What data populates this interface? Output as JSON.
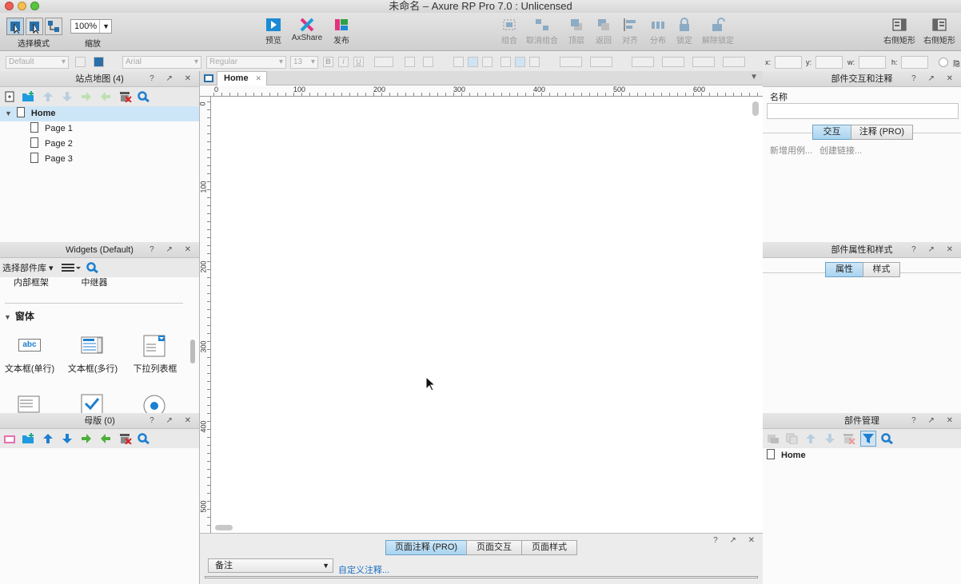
{
  "window": {
    "title": "未命名 – Axure RP Pro 7.0 : Unlicensed"
  },
  "toolbar": {
    "select_mode_label": "选择模式",
    "zoom_value": "100%",
    "zoom_label": "缩放",
    "preview_label": "预览",
    "axshare_label": "AxShare",
    "publish_label": "发布",
    "group_label": "组合",
    "ungroup_label": "取消组合",
    "top_label": "顶层",
    "back_label": "返回",
    "align_label": "对齐",
    "distribute_label": "分布",
    "lock_label": "锁定",
    "unlock_label": "解除锁定",
    "right_rect1_label": "右侧矩形",
    "right_rect2_label": "右侧矩形"
  },
  "format": {
    "style": "Default",
    "font": "Arial",
    "weight": "Regular",
    "size": "13",
    "x_label": "x:",
    "y_label": "y:",
    "w_label": "w:",
    "h_label": "h:",
    "hidden_label": "隐"
  },
  "sitemap": {
    "title": "站点地图 (4)",
    "controls": "? ↗ ✕",
    "home": "Home",
    "pages": [
      "Page 1",
      "Page 2",
      "Page 3"
    ]
  },
  "widgets": {
    "title": "Widgets (Default)",
    "controls": "? ↗ ✕",
    "library_select": "选择部件库",
    "partial_items": [
      "内部框架",
      "中继器"
    ],
    "section": "窗体",
    "items": [
      "文本框(单行)",
      "文本框(多行)",
      "下拉列表框"
    ],
    "icon_text": "abc"
  },
  "masters": {
    "title": "母版 (0)",
    "controls": "? ↗ ✕"
  },
  "canvas": {
    "tab_label": "Home",
    "tab_close": "✕",
    "h_ruler": [
      "0",
      "100",
      "200",
      "300",
      "400",
      "500",
      "600"
    ],
    "v_ruler": [
      "0",
      "100",
      "200",
      "300",
      "400",
      "500"
    ]
  },
  "bottom": {
    "controls": "? ↗ ✕",
    "tabs": [
      "页面注释 (PRO)",
      "页面交互",
      "页面样式"
    ],
    "notes_select": "备注",
    "custom_link": "自定义注释..."
  },
  "interactions": {
    "title": "部件交互和注释",
    "controls": "? ↗ ✕",
    "name_label": "名称",
    "tabs": [
      "交互",
      "注释 (PRO)"
    ],
    "new_case": "新增用例...",
    "create_link": "创建链接..."
  },
  "properties": {
    "title": "部件属性和样式",
    "controls": "? ↗ ✕",
    "tabs": [
      "属性",
      "样式"
    ]
  },
  "manager": {
    "title": "部件管理",
    "controls": "? ↗ ✕",
    "home": "Home"
  },
  "colors": {
    "accent": "#1e9be0",
    "selection": "#cde6f7",
    "canvas": "#ffffff"
  }
}
